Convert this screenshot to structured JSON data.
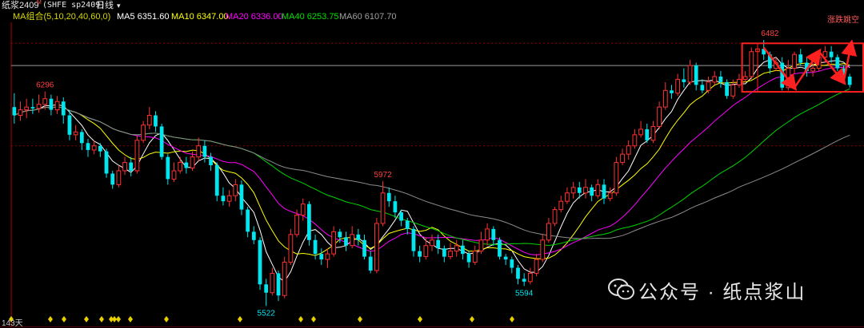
{
  "header": {
    "symbol_name": "纸浆2409",
    "superscript": "M",
    "symbol_code": "(SHFE sp2409)",
    "period": "日线",
    "period_caret": "▾"
  },
  "ma_legend": [
    {
      "label": "MA组合(5,10,20,40,60,0)",
      "color": "#d8d800"
    },
    {
      "label": "MA5 6351.60",
      "color": "#ffffff"
    },
    {
      "label": "MA10 6347.00",
      "color": "#ffff00"
    },
    {
      "label": "MA20 6336.00",
      "color": "#ff00ff"
    },
    {
      "label": "MA40 6253.75",
      "color": "#00e000"
    },
    {
      "label": "MA60 6107.70",
      "color": "#a0a0a0"
    }
  ],
  "signal_label": "涨跌跳空",
  "footer": {
    "days": "143天"
  },
  "watermark": {
    "text": "公众号 · 纸点浆山"
  },
  "chart_data": {
    "type": "candlestick",
    "up_color": "#ff3232",
    "down_color": "#00e5ee",
    "annotations": [
      {
        "label": "6296",
        "index": 5,
        "value": 6296,
        "position": "above",
        "color": "#ff4040"
      },
      {
        "label": "5522",
        "index": 41,
        "value": 5522,
        "position": "below",
        "color": "#00e5ee"
      },
      {
        "label": "5972",
        "index": 60,
        "value": 5972,
        "position": "above",
        "color": "#ff4040"
      },
      {
        "label": "5594",
        "index": 83,
        "value": 5594,
        "position": "below",
        "color": "#00e5ee"
      },
      {
        "label": "6482",
        "index": 123,
        "value": 6482,
        "position": "above",
        "color": "#ff4040"
      }
    ],
    "candles": [
      [
        6240,
        6210,
        6290,
        6180
      ],
      [
        6210,
        6230,
        6260,
        6190
      ],
      [
        6230,
        6240,
        6270,
        6200
      ],
      [
        6240,
        6235,
        6270,
        6215
      ],
      [
        6235,
        6250,
        6285,
        6220
      ],
      [
        6250,
        6270,
        6296,
        6230
      ],
      [
        6270,
        6230,
        6285,
        6210
      ],
      [
        6230,
        6260,
        6280,
        6215
      ],
      [
        6260,
        6210,
        6275,
        6180
      ],
      [
        6210,
        6140,
        6230,
        6120
      ],
      [
        6140,
        6150,
        6175,
        6120
      ],
      [
        6150,
        6110,
        6160,
        6085
      ],
      [
        6110,
        6085,
        6125,
        6060
      ],
      [
        6085,
        6100,
        6120,
        6070
      ],
      [
        6100,
        6080,
        6110,
        6060
      ],
      [
        6080,
        6000,
        6090,
        5985
      ],
      [
        6000,
        5960,
        6010,
        5945
      ],
      [
        5960,
        6010,
        6030,
        5950
      ],
      [
        6010,
        6040,
        6060,
        5995
      ],
      [
        6040,
        6010,
        6060,
        5990
      ],
      [
        6010,
        6120,
        6135,
        6000
      ],
      [
        6120,
        6175,
        6190,
        6110
      ],
      [
        6175,
        6210,
        6240,
        6160
      ],
      [
        6210,
        6170,
        6225,
        6150
      ],
      [
        6170,
        6060,
        6180,
        6050
      ],
      [
        6060,
        5980,
        6070,
        5960
      ],
      [
        5980,
        6010,
        6040,
        5970
      ],
      [
        6010,
        6040,
        6060,
        6000
      ],
      [
        6040,
        6020,
        6060,
        6000
      ],
      [
        6020,
        6060,
        6080,
        6010
      ],
      [
        6060,
        6100,
        6130,
        6045
      ],
      [
        6100,
        6060,
        6120,
        6040
      ],
      [
        6060,
        6030,
        6075,
        6010
      ],
      [
        6030,
        5920,
        6040,
        5900
      ],
      [
        5920,
        5900,
        5950,
        5885
      ],
      [
        5900,
        5920,
        5940,
        5880
      ],
      [
        5920,
        5960,
        5980,
        5900
      ],
      [
        5960,
        5870,
        5975,
        5850
      ],
      [
        5870,
        5790,
        5880,
        5770
      ],
      [
        5790,
        5760,
        5810,
        5745
      ],
      [
        5760,
        5600,
        5770,
        5580
      ],
      [
        5600,
        5570,
        5620,
        5522
      ],
      [
        5570,
        5640,
        5660,
        5560
      ],
      [
        5640,
        5560,
        5650,
        5540
      ],
      [
        5560,
        5680,
        5700,
        5550
      ],
      [
        5680,
        5780,
        5800,
        5670
      ],
      [
        5780,
        5850,
        5870,
        5770
      ],
      [
        5850,
        5890,
        5910,
        5830
      ],
      [
        5890,
        5760,
        5900,
        5740
      ],
      [
        5760,
        5710,
        5780,
        5690
      ],
      [
        5710,
        5690,
        5730,
        5670
      ],
      [
        5690,
        5710,
        5730,
        5660
      ],
      [
        5710,
        5790,
        5810,
        5700
      ],
      [
        5790,
        5770,
        5800,
        5750
      ],
      [
        5770,
        5740,
        5790,
        5720
      ],
      [
        5740,
        5780,
        5810,
        5730
      ],
      [
        5780,
        5760,
        5800,
        5740
      ],
      [
        5760,
        5700,
        5780,
        5690
      ],
      [
        5700,
        5650,
        5720,
        5640
      ],
      [
        5650,
        5820,
        5840,
        5640
      ],
      [
        5820,
        5930,
        5972,
        5810
      ],
      [
        5930,
        5900,
        5950,
        5880
      ],
      [
        5900,
        5860,
        5920,
        5840
      ],
      [
        5860,
        5830,
        5870,
        5810
      ],
      [
        5830,
        5800,
        5840,
        5780
      ],
      [
        5800,
        5720,
        5810,
        5700
      ],
      [
        5720,
        5700,
        5740,
        5680
      ],
      [
        5700,
        5740,
        5770,
        5690
      ],
      [
        5740,
        5760,
        5780,
        5720
      ],
      [
        5760,
        5730,
        5780,
        5710
      ],
      [
        5730,
        5700,
        5740,
        5680
      ],
      [
        5700,
        5720,
        5750,
        5690
      ],
      [
        5720,
        5740,
        5760,
        5700
      ],
      [
        5740,
        5710,
        5760,
        5690
      ],
      [
        5710,
        5680,
        5720,
        5660
      ],
      [
        5680,
        5720,
        5740,
        5670
      ],
      [
        5720,
        5760,
        5790,
        5710
      ],
      [
        5760,
        5800,
        5820,
        5740
      ],
      [
        5800,
        5760,
        5810,
        5740
      ],
      [
        5760,
        5700,
        5770,
        5690
      ],
      [
        5700,
        5690,
        5710,
        5670
      ],
      [
        5690,
        5660,
        5700,
        5640
      ],
      [
        5660,
        5620,
        5670,
        5600
      ],
      [
        5620,
        5610,
        5640,
        5594
      ],
      [
        5610,
        5640,
        5660,
        5600
      ],
      [
        5640,
        5690,
        5710,
        5630
      ],
      [
        5690,
        5760,
        5780,
        5680
      ],
      [
        5760,
        5820,
        5840,
        5750
      ],
      [
        5820,
        5870,
        5880,
        5810
      ],
      [
        5870,
        5900,
        5920,
        5860
      ],
      [
        5900,
        5930,
        5950,
        5890
      ],
      [
        5930,
        5950,
        5970,
        5910
      ],
      [
        5950,
        5930,
        5970,
        5910
      ],
      [
        5930,
        5950,
        5980,
        5910
      ],
      [
        5950,
        5920,
        5960,
        5900
      ],
      [
        5920,
        5960,
        5980,
        5910
      ],
      [
        5960,
        5910,
        5980,
        5890
      ],
      [
        5910,
        5930,
        5950,
        5900
      ],
      [
        5930,
        6040,
        6060,
        5920
      ],
      [
        6040,
        6070,
        6090,
        6030
      ],
      [
        6070,
        6100,
        6120,
        6050
      ],
      [
        6100,
        6140,
        6160,
        6090
      ],
      [
        6140,
        6160,
        6190,
        6130
      ],
      [
        6160,
        6120,
        6180,
        6110
      ],
      [
        6120,
        6170,
        6190,
        6110
      ],
      [
        6170,
        6240,
        6260,
        6160
      ],
      [
        6240,
        6300,
        6330,
        6230
      ],
      [
        6300,
        6290,
        6320,
        6270
      ],
      [
        6290,
        6340,
        6360,
        6280
      ],
      [
        6340,
        6330,
        6380,
        6310
      ],
      [
        6330,
        6390,
        6410,
        6320
      ],
      [
        6390,
        6320,
        6400,
        6300
      ],
      [
        6320,
        6300,
        6340,
        6290
      ],
      [
        6300,
        6330,
        6350,
        6290
      ],
      [
        6330,
        6350,
        6370,
        6320
      ],
      [
        6350,
        6330,
        6370,
        6310
      ],
      [
        6330,
        6280,
        6340,
        6270
      ],
      [
        6280,
        6320,
        6340,
        6270
      ],
      [
        6320,
        6340,
        6360,
        6310
      ],
      [
        6340,
        6350,
        6370,
        6330
      ],
      [
        6350,
        6440,
        6455,
        6340
      ],
      [
        6440,
        6450,
        6470,
        6430
      ],
      [
        6450,
        6430,
        6482,
        6410
      ],
      [
        6430,
        6380,
        6440,
        6360
      ],
      [
        6380,
        6400,
        6420,
        6370
      ],
      [
        6400,
        6310,
        6420,
        6300
      ],
      [
        6310,
        6380,
        6410,
        6300
      ],
      [
        6380,
        6430,
        6440,
        6360
      ],
      [
        6430,
        6400,
        6450,
        6390
      ],
      [
        6400,
        6370,
        6420,
        6350
      ],
      [
        6370,
        6380,
        6400,
        6350
      ],
      [
        6380,
        6420,
        6440,
        6370
      ],
      [
        6420,
        6440,
        6460,
        6400
      ],
      [
        6440,
        6420,
        6460,
        6400
      ],
      [
        6420,
        6380,
        6430,
        6370
      ],
      [
        6380,
        6350,
        6390,
        6330
      ],
      [
        6350,
        6320,
        6360,
        6310
      ]
    ],
    "ylim": [
      5480,
      6540
    ],
    "x_count": 137
  }
}
